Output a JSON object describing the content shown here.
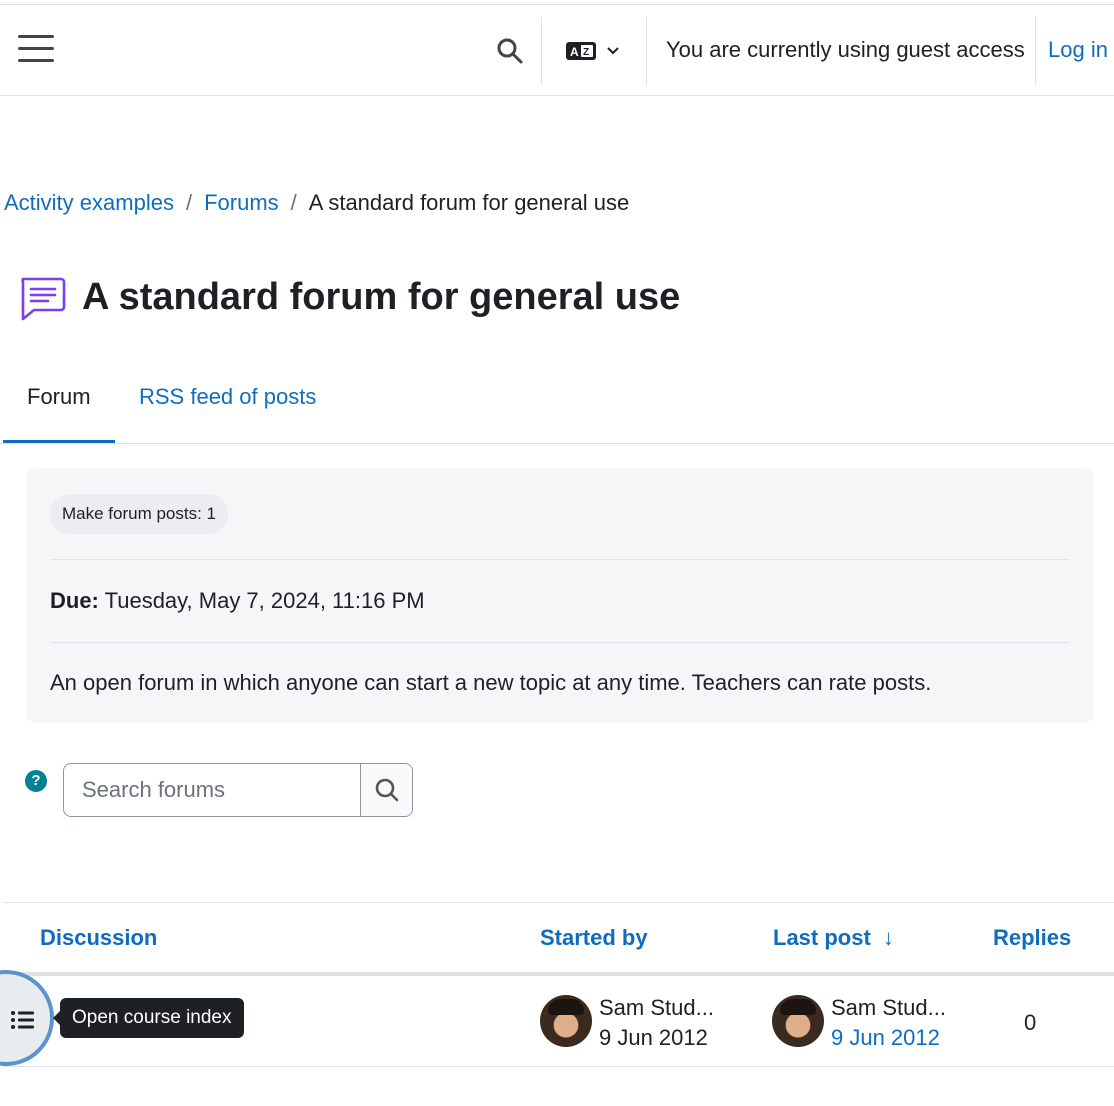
{
  "navbar": {
    "menu_icon": "hamburger-menu-icon",
    "search_icon": "search-icon",
    "language_icon": "language-icon",
    "guest_text": "You are currently using guest access",
    "login_label": "Log in"
  },
  "breadcrumb": {
    "items": [
      "Activity examples",
      "Forums",
      "A standard forum for general use"
    ],
    "separator": "/"
  },
  "page": {
    "icon": "forum-icon",
    "title": "A standard forum for general use"
  },
  "tabs": [
    {
      "label": "Forum",
      "active": true
    },
    {
      "label": "RSS feed of posts",
      "active": false
    }
  ],
  "activity_info": {
    "completion_badge": "Make forum posts: 1",
    "due_label": "Due:",
    "due_value": " Tuesday, May 7, 2024, 11:16 PM",
    "description": "An open forum in which anyone can start a new topic at any time. Teachers can rate posts."
  },
  "search": {
    "placeholder": "Search forums",
    "help_symbol": "?"
  },
  "discussion_table": {
    "headers": {
      "discussion": "Discussion",
      "started_by": "Started by",
      "last_post": "Last post",
      "replies": "Replies"
    },
    "sort_indicator": "↓",
    "rows": [
      {
        "started_by_name": "Sam Stud...",
        "started_date": "9 Jun 2012",
        "last_post_name": "Sam Stud...",
        "last_post_date": "9 Jun 2012",
        "replies": "0"
      }
    ]
  },
  "course_index": {
    "toggle_icon": "list-icon",
    "tooltip": "Open course index"
  },
  "colors": {
    "link": "#0f6cbf",
    "text": "#1d2125",
    "info_background": "#f5f6f8",
    "help_icon": "#008196"
  }
}
